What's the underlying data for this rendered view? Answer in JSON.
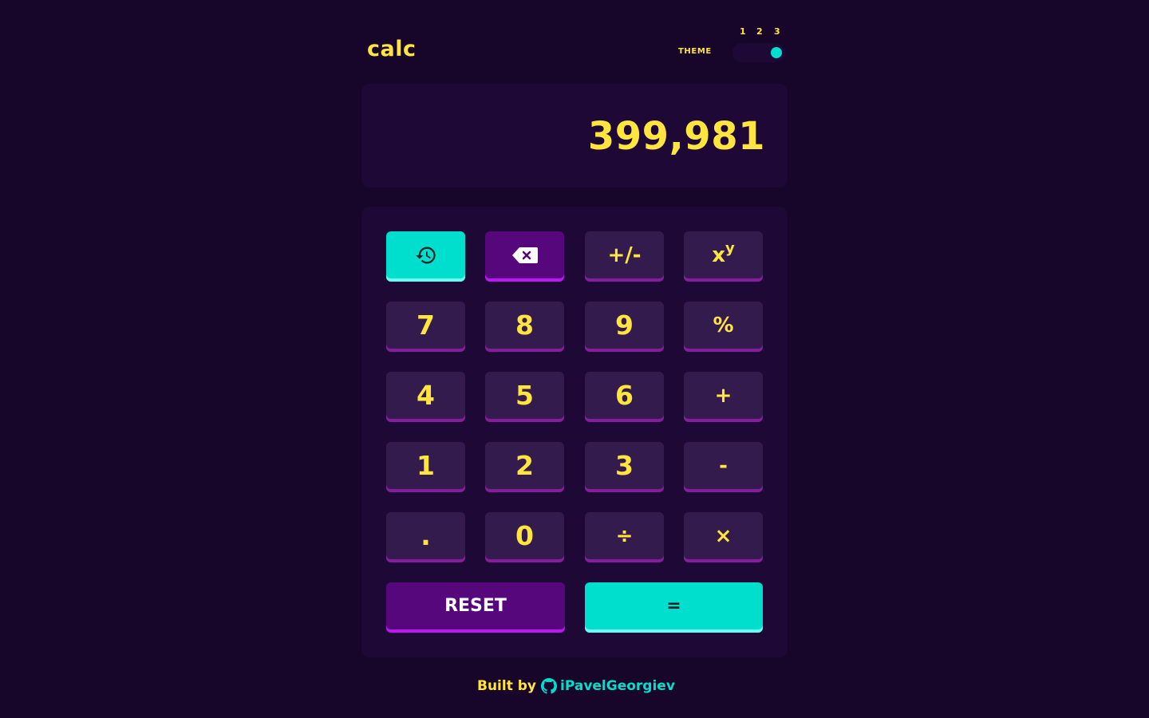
{
  "header": {
    "logo": "calc",
    "theme_label": "THEME",
    "theme_options": [
      "1",
      "2",
      "3"
    ],
    "active_theme": "3"
  },
  "display": {
    "value": "399,981"
  },
  "keys": {
    "history": "history-icon",
    "delete": "backspace-icon",
    "negate": "+/-",
    "power_base": "x",
    "power_exp": "y",
    "seven": "7",
    "eight": "8",
    "nine": "9",
    "percent": "%",
    "four": "4",
    "five": "5",
    "six": "6",
    "plus": "+",
    "one": "1",
    "two": "2",
    "three": "3",
    "minus": "-",
    "dot": ".",
    "zero": "0",
    "divide": "÷",
    "multiply": "×",
    "reset": "RESET",
    "equals": "="
  },
  "footer": {
    "built_by": "Built by",
    "author": "iPavelGeorgiev",
    "author_icon": "github-icon"
  },
  "colors": {
    "background": "#17062a",
    "panel": "#1e0836",
    "key": "#331c4d",
    "key_shadow": "#881c9e",
    "accent_cyan": "#00dece",
    "accent_purple": "#56077c",
    "text_yellow": "#ffe53d"
  }
}
